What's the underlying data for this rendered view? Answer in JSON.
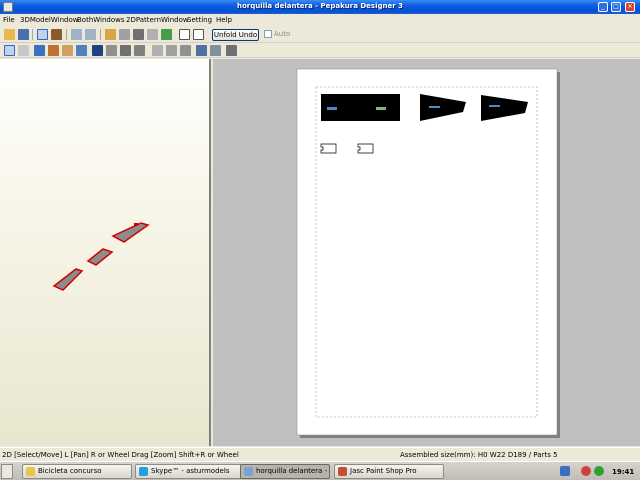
{
  "window": {
    "title": "horquilla delantera - Pepakura Designer 3"
  },
  "menu": [
    "File",
    "3DModelWindow",
    "BothWindows",
    "2DPatternWindow",
    "Setting",
    "Help"
  ],
  "toolbar": {
    "unfold_button": "Unfold Undo",
    "auto_label": "Auto",
    "auto_checked": false
  },
  "status": {
    "left": "2D [Select/Move] L [Pan] R or Wheel Drag [Zoom] Shift+R or Wheel",
    "right": "Assembled size(mm): H0 W22 D189 / Parts 5"
  },
  "taskbar": {
    "tasks": [
      {
        "label": "Bicicleta concurso",
        "icon": "folder-icon",
        "color": "#e8c44b"
      },
      {
        "label": "Skype™ - asturmodels",
        "icon": "skype-icon",
        "color": "#21a0e0"
      },
      {
        "label": "horquilla delantera - ...",
        "icon": "pepakura-icon",
        "color": "#7aa2d8"
      },
      {
        "label": "Jasc Paint Shop Pro",
        "icon": "paintshop-icon",
        "color": "#c05030"
      }
    ],
    "active_task": 2,
    "clock": "19:41"
  },
  "colors": {
    "accent": "#0a5ce0",
    "part_outline": "#d00000",
    "part_fill": "#8c8c8c"
  }
}
